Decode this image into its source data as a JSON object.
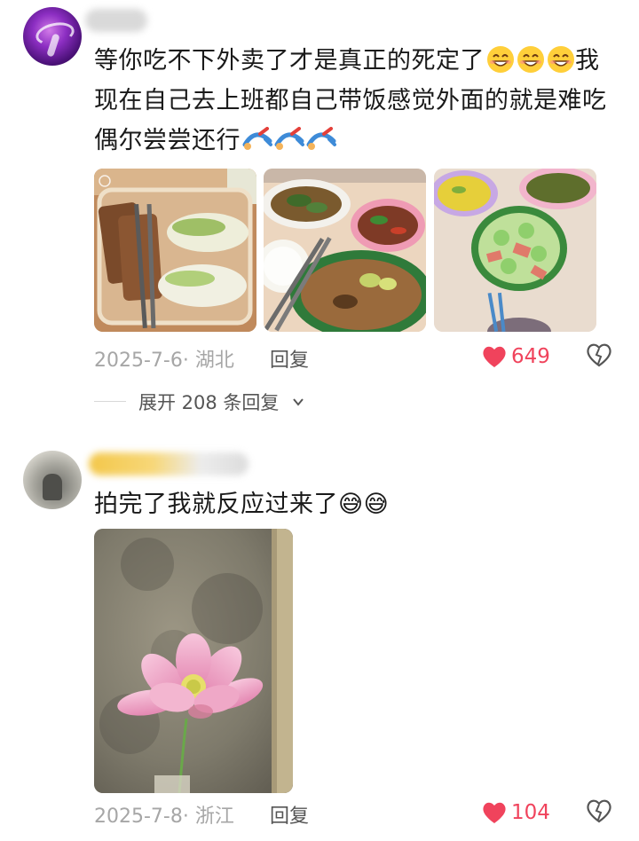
{
  "comments": [
    {
      "text": "等你吃不下外卖了才是真正的死定了😁😁😁我现在自己去上班都自己带饭感觉外面的就是难吃偶尔尝尝还行🤸🤸🤸",
      "text_parts": {
        "line_a": "等你吃不下外卖了才是真正的死定了",
        "line_b": "我",
        "line_c": "现在自己去上班都自己带饭感觉外面的就是难吃",
        "line_d": "偶尔尝尝还行"
      },
      "photos": [
        "food-photo-1",
        "food-photo-2",
        "food-photo-3"
      ],
      "date_location": "2025-7-6· 湖北",
      "reply_label": "回复",
      "likes": "649",
      "expand_label": "展开 208 条回复"
    },
    {
      "text": "拍完了我就反应过来了😅😅",
      "photos": [
        "lotus-photo"
      ],
      "date_location": "2025-7-8· 浙江",
      "reply_label": "回复",
      "likes": "104"
    }
  ],
  "icons": {
    "like": "heart-icon",
    "dislike": "broken-heart-icon",
    "expand": "chevron-down-icon"
  },
  "colors": {
    "like": "#f0435c",
    "meta": "#a6a6a6",
    "text": "#1a1a1a"
  }
}
